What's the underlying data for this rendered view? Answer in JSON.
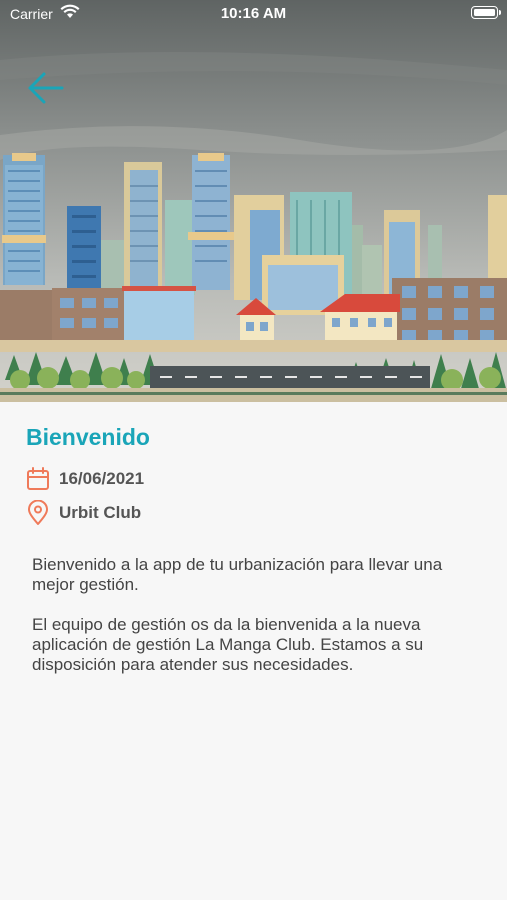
{
  "status_bar": {
    "carrier": "Carrier",
    "time": "10:16 AM"
  },
  "icons": {
    "back": "arrow-left-icon",
    "date": "calendar-icon",
    "location": "location-pin-icon",
    "wifi": "wifi-icon",
    "battery": "battery-icon"
  },
  "colors": {
    "accent": "#1aa5b8",
    "icon_orange": "#ef7a5a",
    "text": "#444444"
  },
  "event": {
    "title": "Bienvenido",
    "date": "16/06/2021",
    "location": "Urbit Club",
    "paragraphs": [
      "Bienvenido a la app de tu urbanización para llevar una mejor gestión.",
      "El equipo de gestión os da la bienvenida a la nueva aplicación de gestión La Manga Club. Estamos a su disposición para atender sus necesidades."
    ]
  }
}
